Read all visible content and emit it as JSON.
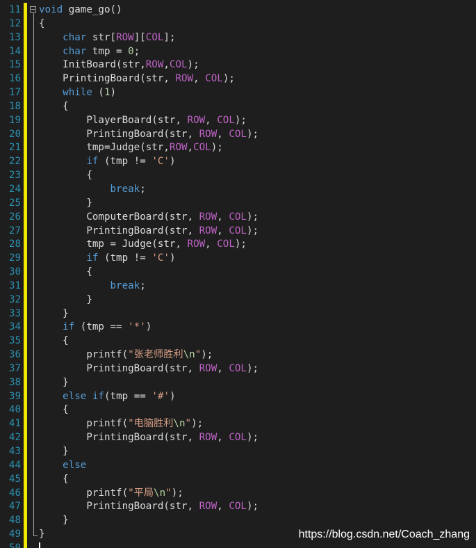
{
  "editor": {
    "lines": [
      {
        "num": "11",
        "fold": true,
        "segments": [
          {
            "t": "void",
            "c": "kw"
          },
          {
            "t": " game_go()",
            "c": ""
          }
        ]
      },
      {
        "num": "12",
        "segments": [
          {
            "t": "{",
            "c": ""
          }
        ]
      },
      {
        "num": "13",
        "segments": [
          {
            "t": "    ",
            "c": ""
          },
          {
            "t": "char",
            "c": "kw"
          },
          {
            "t": " str[",
            "c": ""
          },
          {
            "t": "ROW",
            "c": "mac"
          },
          {
            "t": "][",
            "c": ""
          },
          {
            "t": "COL",
            "c": "mac"
          },
          {
            "t": "];",
            "c": ""
          }
        ]
      },
      {
        "num": "14",
        "segments": [
          {
            "t": "    ",
            "c": ""
          },
          {
            "t": "char",
            "c": "kw"
          },
          {
            "t": " tmp = ",
            "c": ""
          },
          {
            "t": "0",
            "c": "num"
          },
          {
            "t": ";",
            "c": ""
          }
        ]
      },
      {
        "num": "15",
        "segments": [
          {
            "t": "    InitBoard(str,",
            "c": ""
          },
          {
            "t": "ROW",
            "c": "mac"
          },
          {
            "t": ",",
            "c": ""
          },
          {
            "t": "COL",
            "c": "mac"
          },
          {
            "t": ");",
            "c": ""
          }
        ]
      },
      {
        "num": "16",
        "segments": [
          {
            "t": "    PrintingBoard(str, ",
            "c": ""
          },
          {
            "t": "ROW",
            "c": "mac"
          },
          {
            "t": ", ",
            "c": ""
          },
          {
            "t": "COL",
            "c": "mac"
          },
          {
            "t": ");",
            "c": ""
          }
        ]
      },
      {
        "num": "17",
        "segments": [
          {
            "t": "    ",
            "c": ""
          },
          {
            "t": "while",
            "c": "kw"
          },
          {
            "t": " (",
            "c": ""
          },
          {
            "t": "1",
            "c": "num"
          },
          {
            "t": ")",
            "c": ""
          }
        ]
      },
      {
        "num": "18",
        "segments": [
          {
            "t": "    {",
            "c": ""
          }
        ]
      },
      {
        "num": "19",
        "segments": [
          {
            "t": "        PlayerBoard(str, ",
            "c": ""
          },
          {
            "t": "ROW",
            "c": "mac"
          },
          {
            "t": ", ",
            "c": ""
          },
          {
            "t": "COL",
            "c": "mac"
          },
          {
            "t": ");",
            "c": ""
          }
        ]
      },
      {
        "num": "20",
        "segments": [
          {
            "t": "        PrintingBoard(str, ",
            "c": ""
          },
          {
            "t": "ROW",
            "c": "mac"
          },
          {
            "t": ", ",
            "c": ""
          },
          {
            "t": "COL",
            "c": "mac"
          },
          {
            "t": ");",
            "c": ""
          }
        ]
      },
      {
        "num": "21",
        "segments": [
          {
            "t": "        tmp=Judge(str,",
            "c": ""
          },
          {
            "t": "ROW",
            "c": "mac"
          },
          {
            "t": ",",
            "c": ""
          },
          {
            "t": "COL",
            "c": "mac"
          },
          {
            "t": ");",
            "c": ""
          }
        ]
      },
      {
        "num": "22",
        "segments": [
          {
            "t": "        ",
            "c": ""
          },
          {
            "t": "if",
            "c": "kw"
          },
          {
            "t": " (tmp != ",
            "c": ""
          },
          {
            "t": "'C'",
            "c": "str"
          },
          {
            "t": ")",
            "c": ""
          }
        ]
      },
      {
        "num": "23",
        "segments": [
          {
            "t": "        {",
            "c": ""
          }
        ]
      },
      {
        "num": "24",
        "segments": [
          {
            "t": "            ",
            "c": ""
          },
          {
            "t": "break",
            "c": "kw"
          },
          {
            "t": ";",
            "c": ""
          }
        ]
      },
      {
        "num": "25",
        "segments": [
          {
            "t": "        }",
            "c": ""
          }
        ]
      },
      {
        "num": "26",
        "segments": [
          {
            "t": "        ComputerBoard(str, ",
            "c": ""
          },
          {
            "t": "ROW",
            "c": "mac"
          },
          {
            "t": ", ",
            "c": ""
          },
          {
            "t": "COL",
            "c": "mac"
          },
          {
            "t": ");",
            "c": ""
          }
        ]
      },
      {
        "num": "27",
        "segments": [
          {
            "t": "        PrintingBoard(str, ",
            "c": ""
          },
          {
            "t": "ROW",
            "c": "mac"
          },
          {
            "t": ", ",
            "c": ""
          },
          {
            "t": "COL",
            "c": "mac"
          },
          {
            "t": ");",
            "c": ""
          }
        ]
      },
      {
        "num": "28",
        "segments": [
          {
            "t": "        tmp = Judge(str, ",
            "c": ""
          },
          {
            "t": "ROW",
            "c": "mac"
          },
          {
            "t": ", ",
            "c": ""
          },
          {
            "t": "COL",
            "c": "mac"
          },
          {
            "t": ");",
            "c": ""
          }
        ]
      },
      {
        "num": "29",
        "segments": [
          {
            "t": "        ",
            "c": ""
          },
          {
            "t": "if",
            "c": "kw"
          },
          {
            "t": " (tmp != ",
            "c": ""
          },
          {
            "t": "'C'",
            "c": "str"
          },
          {
            "t": ")",
            "c": ""
          }
        ]
      },
      {
        "num": "30",
        "segments": [
          {
            "t": "        {",
            "c": ""
          }
        ]
      },
      {
        "num": "31",
        "segments": [
          {
            "t": "            ",
            "c": ""
          },
          {
            "t": "break",
            "c": "kw"
          },
          {
            "t": ";",
            "c": ""
          }
        ]
      },
      {
        "num": "32",
        "segments": [
          {
            "t": "        }",
            "c": ""
          }
        ]
      },
      {
        "num": "33",
        "segments": [
          {
            "t": "    }",
            "c": ""
          }
        ]
      },
      {
        "num": "34",
        "segments": [
          {
            "t": "    ",
            "c": ""
          },
          {
            "t": "if",
            "c": "kw"
          },
          {
            "t": " (tmp == ",
            "c": ""
          },
          {
            "t": "'*'",
            "c": "str"
          },
          {
            "t": ")",
            "c": ""
          }
        ]
      },
      {
        "num": "35",
        "segments": [
          {
            "t": "    {",
            "c": ""
          }
        ]
      },
      {
        "num": "36",
        "segments": [
          {
            "t": "        printf(",
            "c": ""
          },
          {
            "t": "\"张老师胜利",
            "c": "str"
          },
          {
            "t": "\\n",
            "c": "esc"
          },
          {
            "t": "\"",
            "c": "str"
          },
          {
            "t": ");",
            "c": ""
          }
        ]
      },
      {
        "num": "37",
        "segments": [
          {
            "t": "        PrintingBoard(str, ",
            "c": ""
          },
          {
            "t": "ROW",
            "c": "mac"
          },
          {
            "t": ", ",
            "c": ""
          },
          {
            "t": "COL",
            "c": "mac"
          },
          {
            "t": ");",
            "c": ""
          }
        ]
      },
      {
        "num": "38",
        "segments": [
          {
            "t": "    }",
            "c": ""
          }
        ]
      },
      {
        "num": "39",
        "segments": [
          {
            "t": "    ",
            "c": ""
          },
          {
            "t": "else",
            "c": "kw"
          },
          {
            "t": " ",
            "c": ""
          },
          {
            "t": "if",
            "c": "kw"
          },
          {
            "t": "(tmp == ",
            "c": ""
          },
          {
            "t": "'#'",
            "c": "str"
          },
          {
            "t": ")",
            "c": ""
          }
        ]
      },
      {
        "num": "40",
        "segments": [
          {
            "t": "    {",
            "c": ""
          }
        ]
      },
      {
        "num": "41",
        "segments": [
          {
            "t": "        printf(",
            "c": ""
          },
          {
            "t": "\"电脑胜利",
            "c": "str"
          },
          {
            "t": "\\n",
            "c": "esc"
          },
          {
            "t": "\"",
            "c": "str"
          },
          {
            "t": ");",
            "c": ""
          }
        ]
      },
      {
        "num": "42",
        "segments": [
          {
            "t": "        PrintingBoard(str, ",
            "c": ""
          },
          {
            "t": "ROW",
            "c": "mac"
          },
          {
            "t": ", ",
            "c": ""
          },
          {
            "t": "COL",
            "c": "mac"
          },
          {
            "t": ");",
            "c": ""
          }
        ]
      },
      {
        "num": "43",
        "segments": [
          {
            "t": "    }",
            "c": ""
          }
        ]
      },
      {
        "num": "44",
        "segments": [
          {
            "t": "    ",
            "c": ""
          },
          {
            "t": "else",
            "c": "kw"
          }
        ]
      },
      {
        "num": "45",
        "segments": [
          {
            "t": "    {",
            "c": ""
          }
        ]
      },
      {
        "num": "46",
        "segments": [
          {
            "t": "        printf(",
            "c": ""
          },
          {
            "t": "\"平局",
            "c": "str"
          },
          {
            "t": "\\n",
            "c": "esc"
          },
          {
            "t": "\"",
            "c": "str"
          },
          {
            "t": ");",
            "c": ""
          }
        ]
      },
      {
        "num": "47",
        "segments": [
          {
            "t": "        PrintingBoard(str, ",
            "c": ""
          },
          {
            "t": "ROW",
            "c": "mac"
          },
          {
            "t": ", ",
            "c": ""
          },
          {
            "t": "COL",
            "c": "mac"
          },
          {
            "t": ");",
            "c": ""
          }
        ]
      },
      {
        "num": "48",
        "segments": [
          {
            "t": "    }",
            "c": ""
          }
        ]
      },
      {
        "num": "49",
        "segments": [
          {
            "t": "}",
            "c": ""
          }
        ]
      },
      {
        "num": "50",
        "segments": []
      }
    ]
  },
  "watermark": "https://blog.csdn.net/Coach_zhang",
  "colors": {
    "background": "#1e1e1e",
    "keyword": "#569cd6",
    "macro": "#bd63c5",
    "string": "#d69d85",
    "line_number": "#2b91af",
    "change_bar": "#f2e700"
  }
}
